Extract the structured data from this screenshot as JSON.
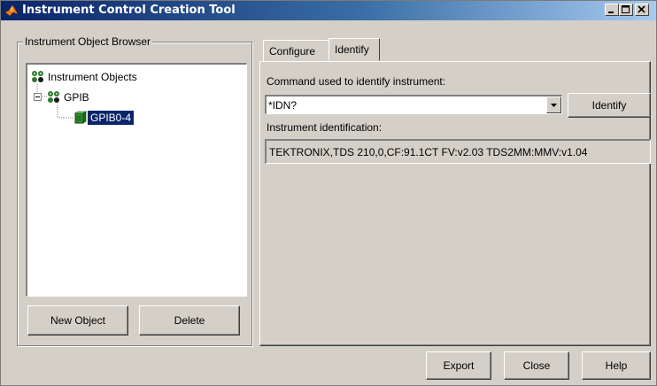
{
  "window": {
    "title": "Instrument Control Creation Tool",
    "title_bar_colors": [
      "#0a246a",
      "#a6caf0"
    ]
  },
  "caption_buttons": {
    "minimize": "minimize-icon",
    "maximize": "maximize-icon",
    "close": "close-icon"
  },
  "browser": {
    "legend": "Instrument Object Browser",
    "tree": {
      "root": {
        "label": "Instrument Objects",
        "icon": "instrument-objects-icon"
      },
      "group": {
        "label": "GPIB",
        "icon": "gpib-icon",
        "expanded": true
      },
      "item": {
        "label": "GPIB0-4",
        "icon": "gpib-object-icon",
        "selected": true
      }
    },
    "new_object_label": "New Object",
    "delete_label": "Delete"
  },
  "tabs": [
    {
      "label": "Configure",
      "active": false
    },
    {
      "label": "Identify",
      "active": true
    }
  ],
  "identify": {
    "command_label": "Command used to identify instrument:",
    "command_value": "*IDN?",
    "identify_button_label": "Identify",
    "identification_label": "Instrument identification:",
    "identification_value": "TEKTRONIX,TDS 210,0,CF:91.1CT FV:v2.03 TDS2MM:MMV:v1.04"
  },
  "footer": {
    "export_label": "Export",
    "close_label": "Close",
    "help_label": "Help"
  }
}
